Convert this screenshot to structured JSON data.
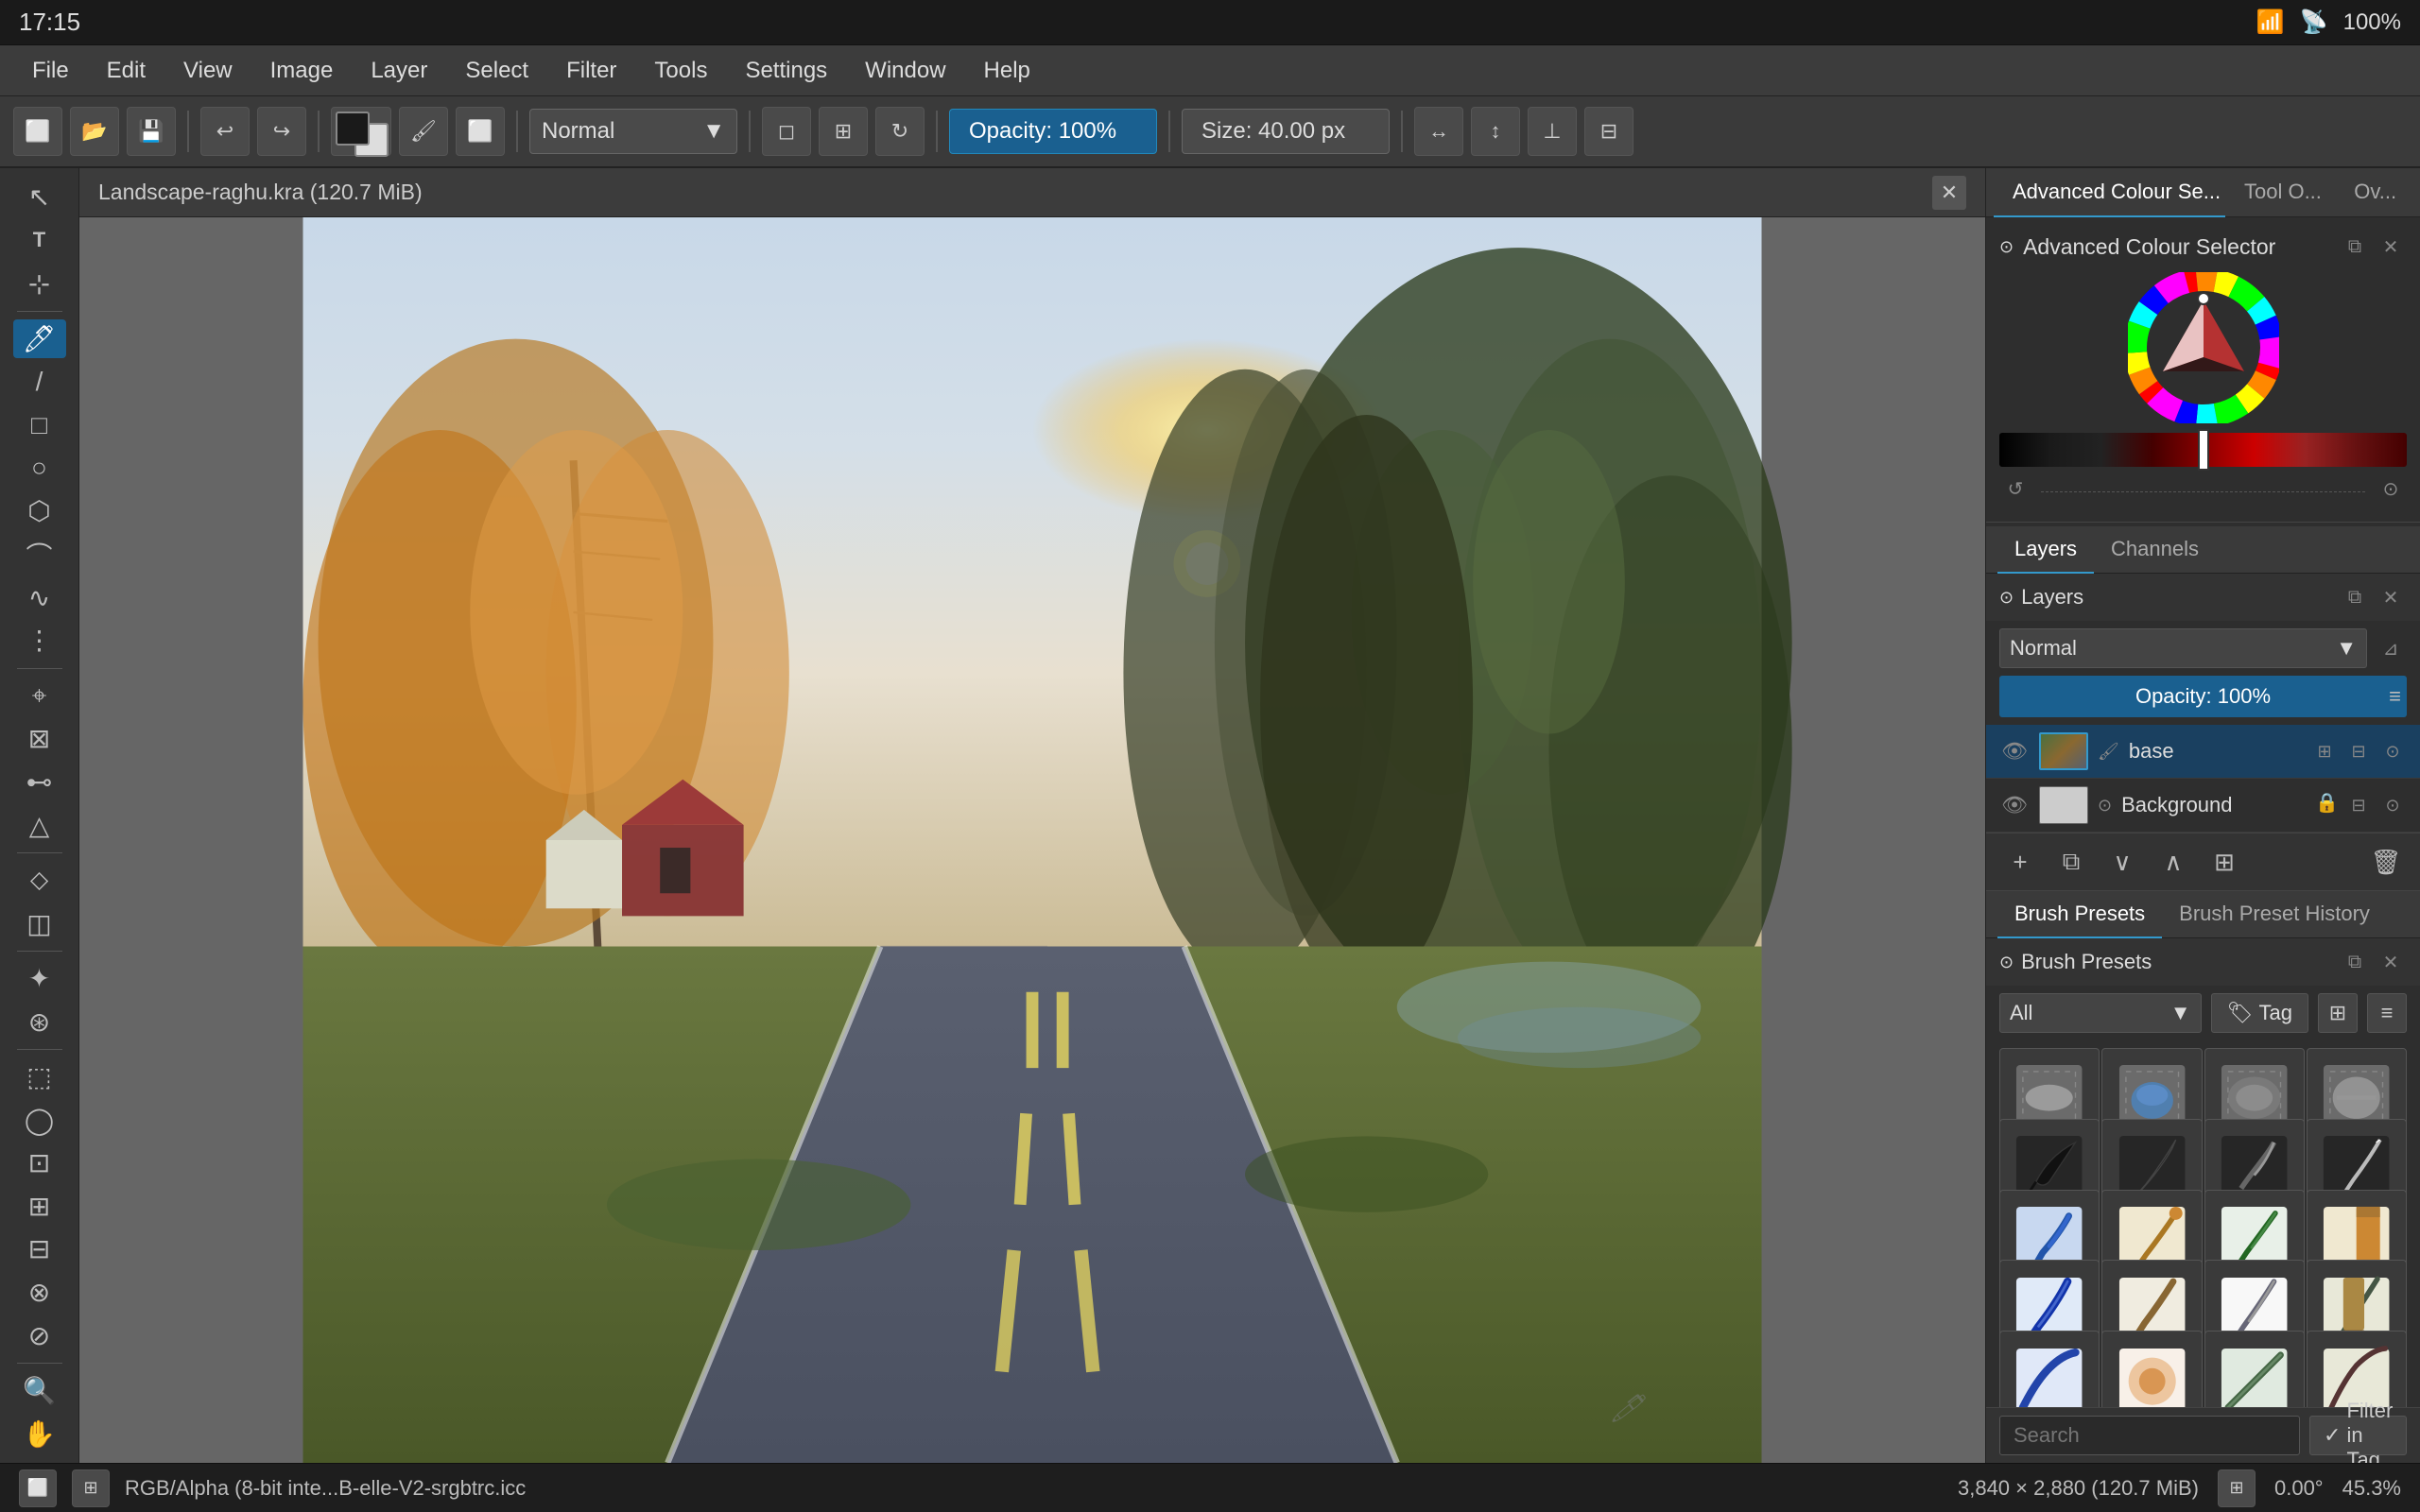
{
  "titlebar": {
    "time": "17:15",
    "battery": "100%",
    "wifi": "WiFi",
    "signal": "Signal"
  },
  "menubar": {
    "items": [
      "File",
      "Edit",
      "View",
      "Image",
      "Layer",
      "Select",
      "Filter",
      "Tools",
      "Settings",
      "Window",
      "Help"
    ]
  },
  "toolbar": {
    "blend_mode": "Normal",
    "opacity_label": "Opacity: 100%",
    "size_label": "Size: 40.00 px"
  },
  "document": {
    "title": "Landscape-raghu.kra (120.7 MiB)"
  },
  "color_panel": {
    "title": "Advanced Colour Selector",
    "tab1": "Advanced Colour Se...",
    "tab2": "Tool O...",
    "tab3": "Ov..."
  },
  "layers_panel": {
    "title": "Layers",
    "tabs": [
      "Layers",
      "Channels"
    ],
    "blend_mode": "Normal",
    "opacity_label": "Opacity:  100%",
    "layers": [
      {
        "name": "base",
        "visible": true,
        "active": true
      },
      {
        "name": "Background",
        "visible": true,
        "active": false,
        "locked": true
      }
    ]
  },
  "brush_presets": {
    "tab1": "Brush Presets",
    "tab2": "Brush Preset History",
    "panel_title": "Brush Presets",
    "filter_label": "All",
    "tag_label": "Tag",
    "search_placeholder": "Search",
    "filter_in_tag": "Filter in Tag"
  },
  "statusbar": {
    "left": "RGB/Alpha (8-bit inte...B-elle-V2-srgbtrc.icc",
    "dimensions": "3,840 × 2,880 (120.7 MiB)",
    "angle": "0.00°",
    "zoom": "45.3%"
  },
  "left_tools": [
    {
      "icon": "↖",
      "name": "select-tool",
      "active": false
    },
    {
      "icon": "T",
      "name": "text-tool",
      "active": false
    },
    {
      "icon": "⊹",
      "name": "transform-tool",
      "active": false
    },
    {
      "icon": "✏",
      "name": "brush-tool",
      "active": true
    },
    {
      "icon": "━",
      "name": "line-tool",
      "active": false
    },
    {
      "icon": "□",
      "name": "rect-tool",
      "active": false
    },
    {
      "icon": "○",
      "name": "ellipse-tool",
      "active": false
    },
    {
      "icon": "◇",
      "name": "polygon-tool",
      "active": false
    },
    {
      "icon": "⊳",
      "name": "arrow-tool",
      "active": false
    },
    {
      "icon": "∿",
      "name": "freehand-tool",
      "active": false
    },
    {
      "icon": "≋",
      "name": "multibrush-tool",
      "active": false
    },
    {
      "icon": "⌖",
      "name": "transform2-tool",
      "active": false
    },
    {
      "icon": "✂",
      "name": "scissors-tool",
      "active": false
    },
    {
      "icon": "⬡",
      "name": "path-tool",
      "active": false
    },
    {
      "icon": "⌀",
      "name": "measure-tool",
      "active": false
    },
    {
      "icon": "△",
      "name": "angle-tool",
      "active": false
    },
    {
      "icon": "⊙",
      "name": "assistant-tool",
      "active": false
    },
    {
      "icon": "◈",
      "name": "fill-tool",
      "active": false
    },
    {
      "icon": "⊕",
      "name": "gradient-tool",
      "active": false
    },
    {
      "icon": "⊗",
      "name": "clone-tool",
      "active": false
    },
    {
      "icon": "🔲",
      "name": "crop-tool",
      "active": false
    },
    {
      "icon": "⊞",
      "name": "reference-tool",
      "active": false
    },
    {
      "icon": "□",
      "name": "rect-select-tool",
      "active": false
    },
    {
      "icon": "○",
      "name": "ellipse-select-tool",
      "active": false
    },
    {
      "icon": "⊛",
      "name": "contiguous-select-tool",
      "active": false
    },
    {
      "icon": "⌘",
      "name": "similar-select-tool",
      "active": false
    },
    {
      "icon": "⬡",
      "name": "bezier-select-tool",
      "active": false
    },
    {
      "icon": "⬠",
      "name": "polygon-select-tool",
      "active": false
    },
    {
      "icon": "◎",
      "name": "zoom-tool",
      "active": false
    },
    {
      "icon": "✋",
      "name": "pan-tool",
      "active": false
    }
  ]
}
